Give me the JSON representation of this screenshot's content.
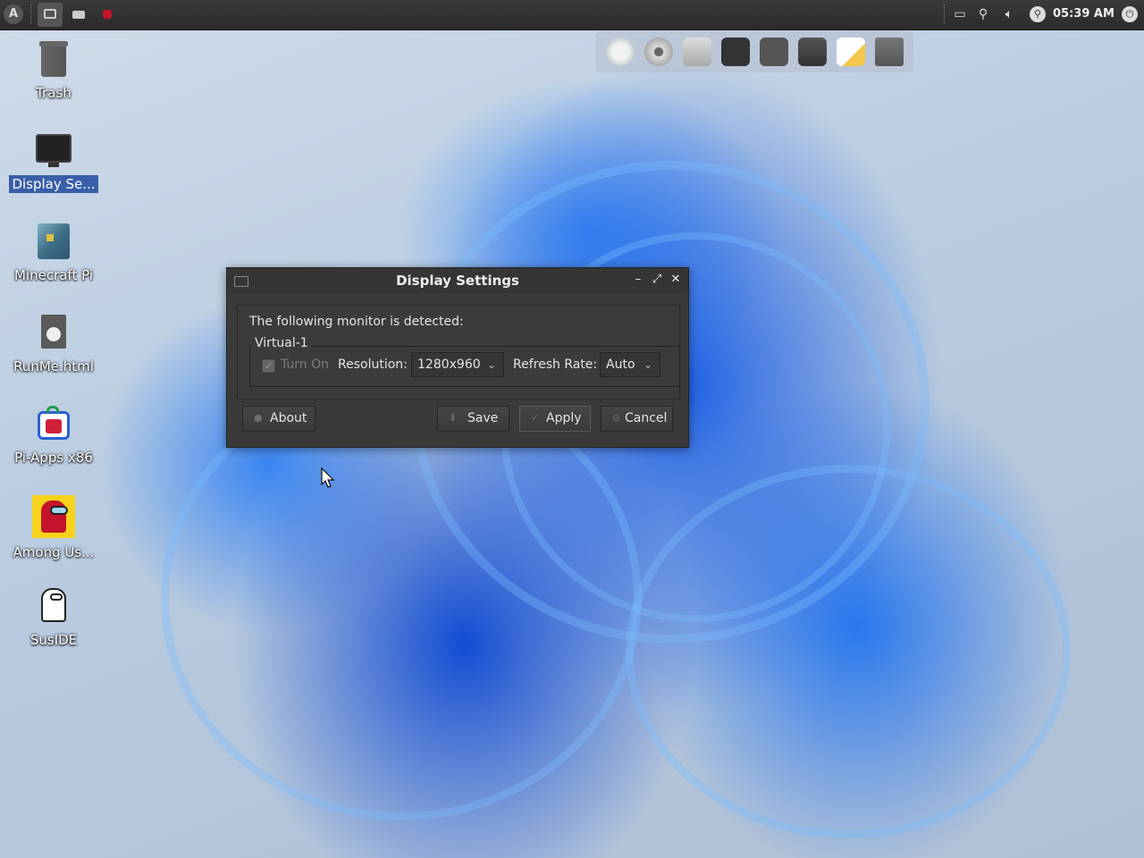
{
  "panel": {
    "clock": "05:39 AM",
    "tasks": [
      "display-settings",
      "window",
      "among-us"
    ],
    "tray_icons": [
      "screen-icon",
      "paperclip-icon",
      "volume-icon",
      "search-icon",
      "power-icon"
    ]
  },
  "dock": {
    "items": [
      "rocket-icon",
      "disc-icon",
      "archive-icon",
      "terminal-icon",
      "calculator-icon",
      "folder-icon",
      "notepad-icon",
      "trash-icon"
    ]
  },
  "desktop": {
    "icons": [
      {
        "label": "Trash",
        "icon": "trash-icon"
      },
      {
        "label": "Display Se...",
        "icon": "monitor-icon",
        "selected": true
      },
      {
        "label": "Minecraft Pi",
        "icon": "minecraft-icon"
      },
      {
        "label": "RunMe.html",
        "icon": "html-file-icon"
      },
      {
        "label": "Pi-Apps x86",
        "icon": "pi-apps-icon"
      },
      {
        "label": "Among Us...",
        "icon": "among-us-icon"
      },
      {
        "label": "SusIDE",
        "icon": "suside-icon"
      }
    ]
  },
  "dialog": {
    "title": "Display Settings",
    "detected_text": "The following monitor is detected:",
    "monitor_name": "Virtual-1",
    "turn_on_label": "Turn On",
    "turn_on_checked": true,
    "resolution_label": "Resolution:",
    "resolution_value": "1280x960",
    "refresh_label": "Refresh Rate:",
    "refresh_value": "Auto",
    "buttons": {
      "about": "About",
      "save": "Save",
      "apply": "Apply",
      "cancel": "Cancel"
    }
  }
}
